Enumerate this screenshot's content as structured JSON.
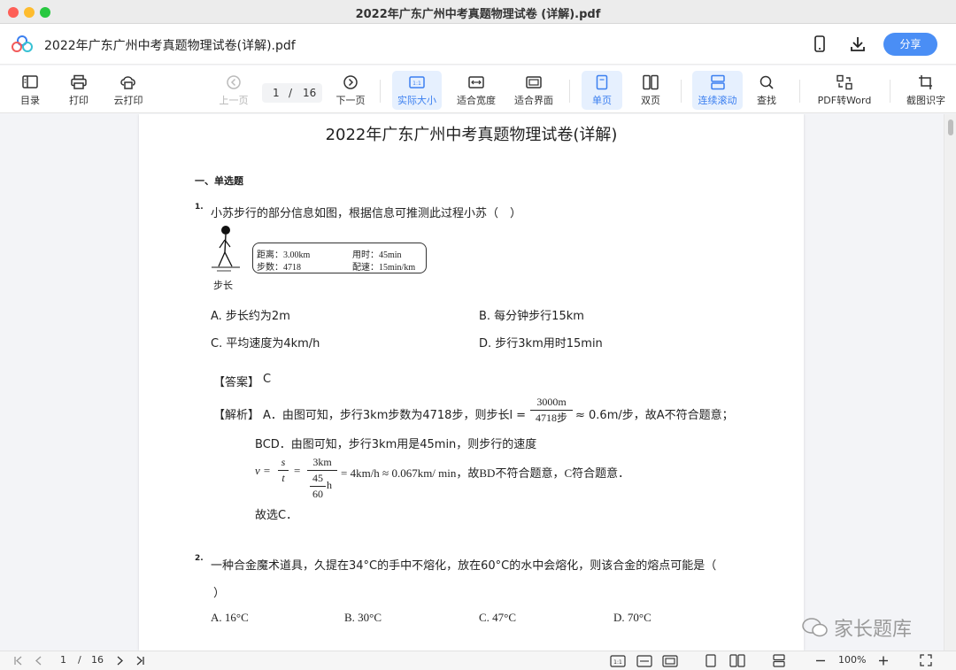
{
  "window": {
    "title": "2022年广东广州中考真题物理试卷 (详解).pdf"
  },
  "appbar": {
    "doc_name": "2022年广东广州中考真题物理试卷(详解).pdf",
    "share_label": "分享"
  },
  "toolbar": {
    "toc_label": "目录",
    "print_label": "打印",
    "cloud_print_label": "云打印",
    "prev_label": "上一页",
    "current_page": "1",
    "page_separator": "/",
    "total_pages": "16",
    "next_label": "下一页",
    "actual_size_label": "实际大小",
    "fit_width_label": "适合宽度",
    "fit_page_label": "适合界面",
    "single_page_label": "单页",
    "double_page_label": "双页",
    "continuous_label": "连续滚动",
    "find_label": "查找",
    "pdf_to_word_label": "PDF转Word",
    "ocr_label": "截图识字",
    "accent_color": "#3b7ff0"
  },
  "document": {
    "title": "2022年广东广州中考真题物理试卷(详解)",
    "section_heading": "一、单选题",
    "q1": {
      "number": "1.",
      "text": "小苏步行的部分信息如图，根据信息可推测此过程小苏（　）",
      "figure": {
        "distance": "距离：3.00km",
        "steps": "步数：4718",
        "time": "用时：45min",
        "pace": "配速：15min/km",
        "step_length_label": "步长"
      },
      "options": [
        "A. 步长约为2m",
        "B. 每分钟步行15km",
        "C. 平均速度为4km/h",
        "D. 步行3km用时15min"
      ],
      "answer_label": "【答案】",
      "answer_value": "C",
      "analysis_label": "【解析】",
      "analysis_line1_a": "A．由图可知，步行3km步数为4718步，则步长l =",
      "analysis_line1_frac_num": "3000m",
      "analysis_line1_frac_den": "4718步",
      "analysis_line1_b": "≈ 0.6m/步，故A不符合题意；",
      "analysis_line2": "BCD．由图可知，步行3km用是45min，则步行的速度",
      "analysis_line3_v": "v =",
      "analysis_line3_s": "s",
      "analysis_line3_t": "t",
      "analysis_line3_eq": "=",
      "analysis_line3_num": "3km",
      "analysis_line3_inner_num": "45",
      "analysis_line3_inner_den": "60",
      "analysis_line3_unit": "h",
      "analysis_line3_tail": "= 4km/h ≈ 0.067km/ min，故BD不符合题意，C符合题意．",
      "analysis_conclusion": "故选C．"
    },
    "q2": {
      "number": "2.",
      "text_line1": "一种合金魔术道具，久提在34°C的手中不熔化，放在60°C的水中会熔化，则该合金的熔点可能是（",
      "text_line2": "）",
      "options": [
        "A. 16°C",
        "B. 30°C",
        "C. 47°C",
        "D. 70°C"
      ]
    }
  },
  "statusbar": {
    "current_page": "1",
    "page_separator": "/",
    "total_pages": "16",
    "zoom": "100%"
  },
  "watermark": {
    "text": "家长题库"
  }
}
